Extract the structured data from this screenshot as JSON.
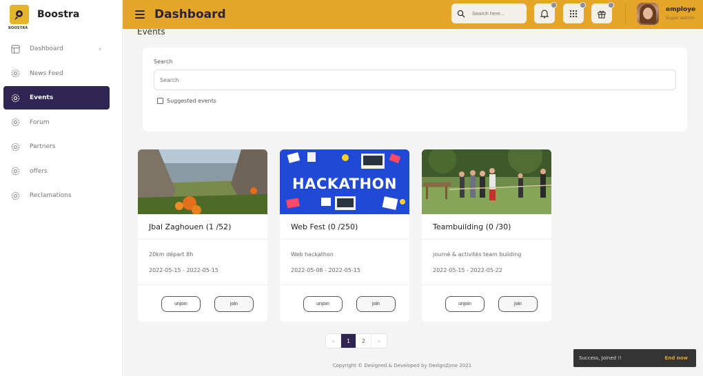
{
  "brand": {
    "name": "Boostra",
    "logo_sub": "BOOSTRA"
  },
  "sidebar": {
    "items": [
      {
        "label": "Dashboard",
        "icon": "dashboard-icon",
        "has_chevron": true,
        "active": false
      },
      {
        "label": "News Feed",
        "icon": "gear-icon",
        "active": false
      },
      {
        "label": "Events",
        "icon": "gear-icon",
        "active": true
      },
      {
        "label": "Forum",
        "icon": "gear-icon",
        "active": false
      },
      {
        "label": "Partners",
        "icon": "gear-icon",
        "active": false
      },
      {
        "label": "offers",
        "icon": "gear-icon",
        "active": false
      },
      {
        "label": "Reclamations",
        "icon": "gear-icon",
        "active": false
      }
    ],
    "chevron": "›"
  },
  "header": {
    "title": "Dashboard",
    "search_placeholder": "Search here...",
    "user_name": "employe",
    "user_role": "Super Admin",
    "icons": [
      "bell-icon",
      "apps-grid-icon",
      "gift-icon"
    ]
  },
  "main": {
    "section_title": "Events",
    "search": {
      "label": "Search",
      "placeholder": "Search"
    },
    "suggested_label": "Suggested events",
    "cards": [
      {
        "title": "Jbal Zaghouen (1 /52)",
        "description": "20km départ 8h",
        "dates": "2022-05-15 - 2022-05-15",
        "unjoin_label": "unjoin",
        "join_label": "join",
        "image": "mountain-flowers"
      },
      {
        "title": "Web Fest (0 /250)",
        "description": "Web hackathon",
        "dates": "2022-05-08 - 2022-05-15",
        "unjoin_label": "unjoin",
        "join_label": "join",
        "image": "hackathon-banner",
        "image_text": "HACKATHON"
      },
      {
        "title": "Teambuilding (0 /30)",
        "description": "journé & activités team building",
        "dates": "2022-05-15 - 2022-05-22",
        "unjoin_label": "unjoin",
        "join_label": "join",
        "image": "tug-of-war"
      }
    ],
    "pagination": {
      "prev": "«",
      "pages": [
        "1",
        "2"
      ],
      "current": "1",
      "next": "»"
    },
    "footer": "Copyright © Designed & Developed by DexignZone 2021"
  },
  "toast": {
    "message": "Success, Joined !!",
    "action": "End now"
  },
  "colors": {
    "accent": "#e5a528",
    "primary": "#2f2552"
  }
}
